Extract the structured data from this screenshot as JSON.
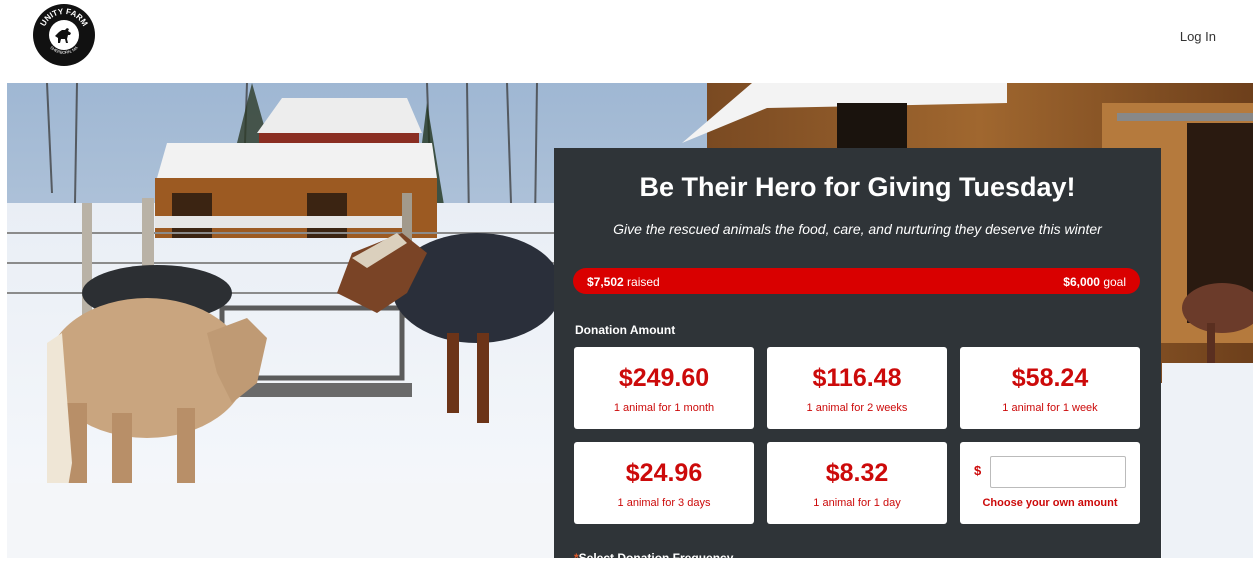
{
  "header": {
    "logo_name": "Unity Farm logo",
    "logo_text": "UNITY FARM",
    "logo_subtext": "SHERBORN, MA",
    "login_label": "Log In"
  },
  "campaign": {
    "title": "Be Their Hero for Giving Tuesday!",
    "subtitle": "Give the rescued animals the food, care, and nurturing they deserve this winter",
    "progress": {
      "raised_amount": "$7,502",
      "raised_label": "raised",
      "goal_amount": "$6,000",
      "goal_label": "goal",
      "fill_fraction": 1.0,
      "bar_color": "#d90000"
    },
    "donation_amount_label": "Donation Amount",
    "options": [
      {
        "price": "$249.60",
        "desc": "1 animal for 1 month"
      },
      {
        "price": "$116.48",
        "desc": "1 animal for 2 weeks"
      },
      {
        "price": "$58.24",
        "desc": "1 animal for 1 week"
      },
      {
        "price": "$24.96",
        "desc": "1 animal for 3 days"
      },
      {
        "price": "$8.32",
        "desc": "1 animal for 1 day"
      }
    ],
    "custom": {
      "currency": "$",
      "value": "",
      "label": "Choose your own amount"
    },
    "frequency_label": "Select Donation Frequency",
    "required_marker": "*"
  },
  "colors": {
    "accent": "#cc0a0a",
    "panel": "#2f3438"
  }
}
